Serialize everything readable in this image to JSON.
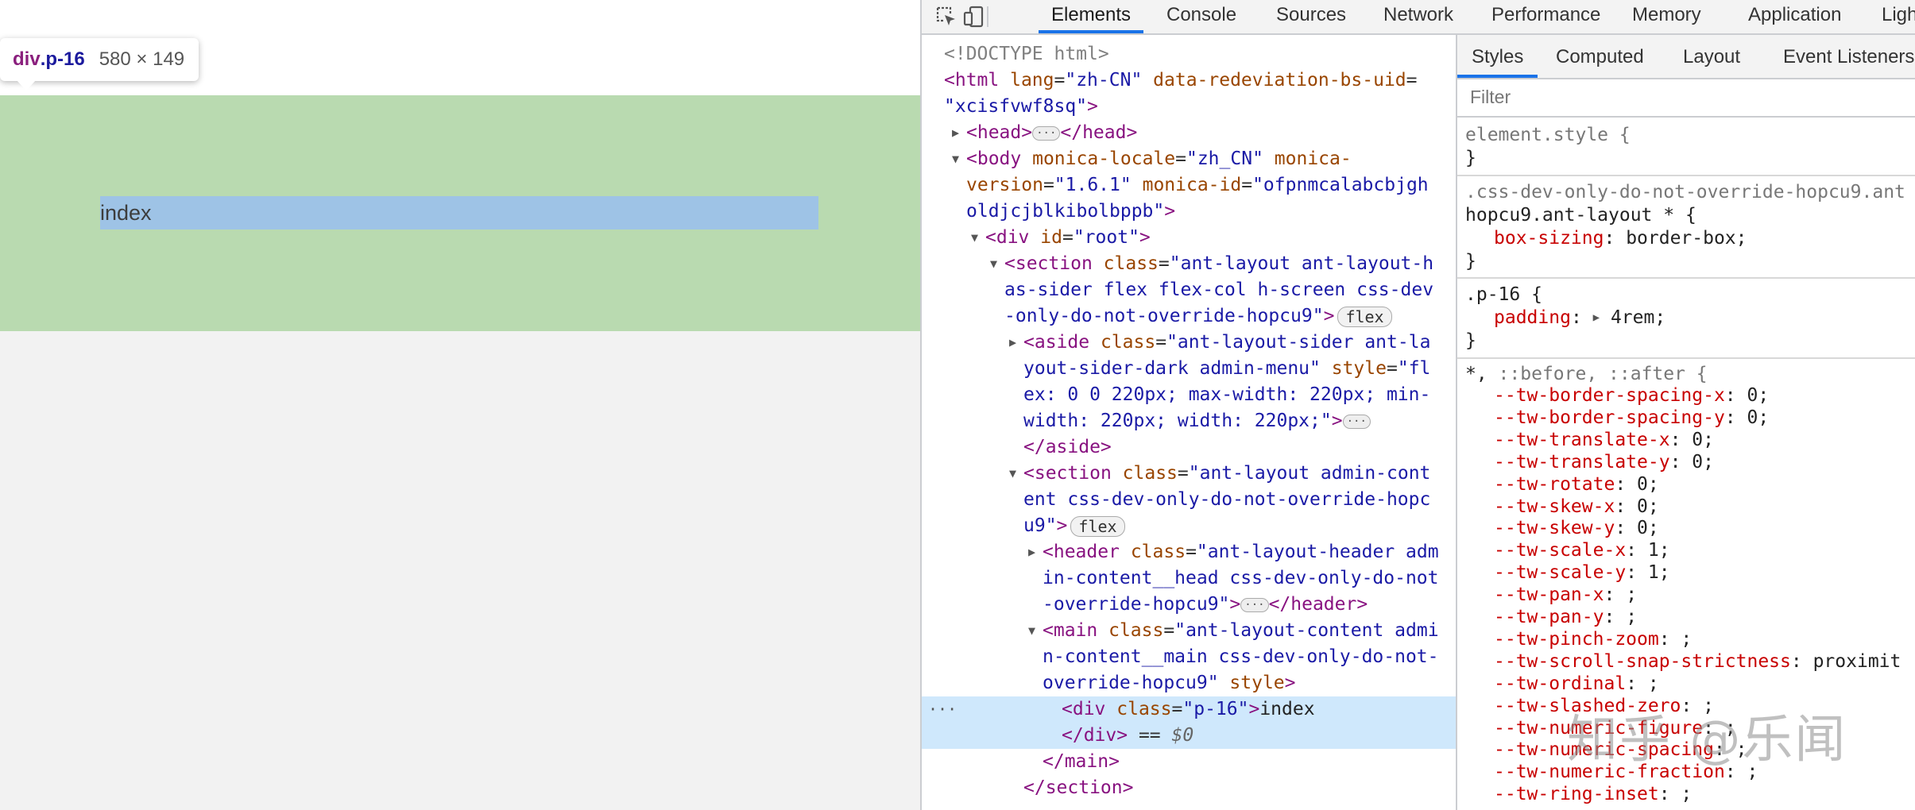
{
  "preview": {
    "tooltip": {
      "tag": "div",
      "class": ".p-16",
      "size": "580 × 149"
    },
    "content_text": "index"
  },
  "devtools": {
    "tabs": [
      "Elements",
      "Console",
      "Sources",
      "Network",
      "Performance",
      "Memory",
      "Application",
      "Ligh"
    ],
    "active_tab": "Elements",
    "dom": {
      "doctype": "<!DOCTYPE html>",
      "html_tag": "html",
      "html_attr_lang": "lang",
      "html_lang": "\"zh-CN\"",
      "html_attr_uid": "data-redeviation-bs-uid",
      "html_uid": "\"xcisfvwf8sq\"",
      "head_open": "<head>",
      "head_close": "</head>",
      "body_tag": "body",
      "body_attr_locale": "monica-locale",
      "body_locale": "\"zh_CN\"",
      "body_attr_version": "monica-",
      "body_attr_version2": "version",
      "body_version": "\"1.6.1\"",
      "body_attr_id": "monica-id",
      "body_id_1": "\"ofpnmcalabcbjgh",
      "body_id_2": "oldjcjblkibolbppb\"",
      "root_tag": "div",
      "root_attr": "id",
      "root_val": "\"root\"",
      "section_tag": "section",
      "section_attr": "class",
      "section_val_1": "\"ant-layout ant-layout-h",
      "section_val_2": "as-sider flex flex-col h-screen css-dev",
      "section_val_3": "-only-do-not-override-hopcu9\"",
      "aside_tag": "aside",
      "aside_attr": "class",
      "aside_val_1": "\"ant-layout-sider ant-la",
      "aside_val_2": "yout-sider-dark admin-menu\"",
      "aside_attr_style": "style",
      "aside_style_1": "\"fl",
      "aside_style_2": "ex: 0 0 220px; max-width: 220px; min-",
      "aside_style_3": "width: 220px; width: 220px;\"",
      "aside_close": "</aside>",
      "section2_tag": "section",
      "section2_attr": "class",
      "section2_val_1": "\"ant-layout admin-cont",
      "section2_val_2": "ent css-dev-only-do-not-override-hopc",
      "section2_val_3": "u9\"",
      "header_tag": "header",
      "header_attr": "class",
      "header_val_1": "\"ant-layout-header adm",
      "header_val_2": "in-content__head css-dev-only-do-not",
      "header_val_3": "-override-hopcu9\"",
      "header_close": "</header>",
      "main_tag": "main",
      "main_attr": "class",
      "main_val_1": "\"ant-layout-content admi",
      "main_val_2": "n-content__main css-dev-only-do-not-",
      "main_val_3": "override-hopcu9\"",
      "main_attr_style": "style",
      "sel_tag": "div",
      "sel_attr": "class",
      "sel_val": "\"p-16\"",
      "sel_text": "index",
      "sel_close": "</div>",
      "sel_eq": " == ",
      "sel_dollar": "$0",
      "main_close": "</main>",
      "section_close": "</section>",
      "flex_badge": "flex",
      "ellipsis": "···"
    },
    "styles": {
      "tabs": [
        "Styles",
        "Computed",
        "Layout",
        "Event Listeners"
      ],
      "active_tab": "Styles",
      "filter_placeholder": "Filter",
      "rules": {
        "element_style": "element.style {",
        "close": "}",
        "antlayout_sel_1": ".css-dev-only-do-not-override-hopcu9.ant",
        "antlayout_sel_2": "hopcu9.ant-layout * {",
        "antlayout_prop": "box-sizing",
        "antlayout_val": "border-box;",
        "p16_sel": ".p-16 {",
        "p16_prop": "padding",
        "p16_val": "4rem;",
        "universal_sel": "*,",
        "universal_pseudo": " ::before, ::after {",
        "tw_props": [
          {
            "name": "--tw-border-spacing-x",
            "value": " 0;"
          },
          {
            "name": "--tw-border-spacing-y",
            "value": " 0;"
          },
          {
            "name": "--tw-translate-x",
            "value": " 0;"
          },
          {
            "name": "--tw-translate-y",
            "value": " 0;"
          },
          {
            "name": "--tw-rotate",
            "value": " 0;"
          },
          {
            "name": "--tw-skew-x",
            "value": " 0;"
          },
          {
            "name": "--tw-skew-y",
            "value": " 0;"
          },
          {
            "name": "--tw-scale-x",
            "value": " 1;"
          },
          {
            "name": "--tw-scale-y",
            "value": " 1;"
          },
          {
            "name": "--tw-pan-x",
            "value": " ;"
          },
          {
            "name": "--tw-pan-y",
            "value": " ;"
          },
          {
            "name": "--tw-pinch-zoom",
            "value": " ;"
          },
          {
            "name": "--tw-scroll-snap-strictness",
            "value": " proximit"
          },
          {
            "name": "--tw-ordinal",
            "value": " ;"
          },
          {
            "name": "--tw-slashed-zero",
            "value": " ;"
          },
          {
            "name": "--tw-numeric-figure",
            "value": " ;"
          },
          {
            "name": "--tw-numeric-spacing",
            "value": " ;"
          },
          {
            "name": "--tw-numeric-fraction",
            "value": " ;"
          },
          {
            "name": "--tw-ring-inset",
            "value": " ;"
          }
        ]
      }
    }
  },
  "watermark": "知乎 @乐闻"
}
